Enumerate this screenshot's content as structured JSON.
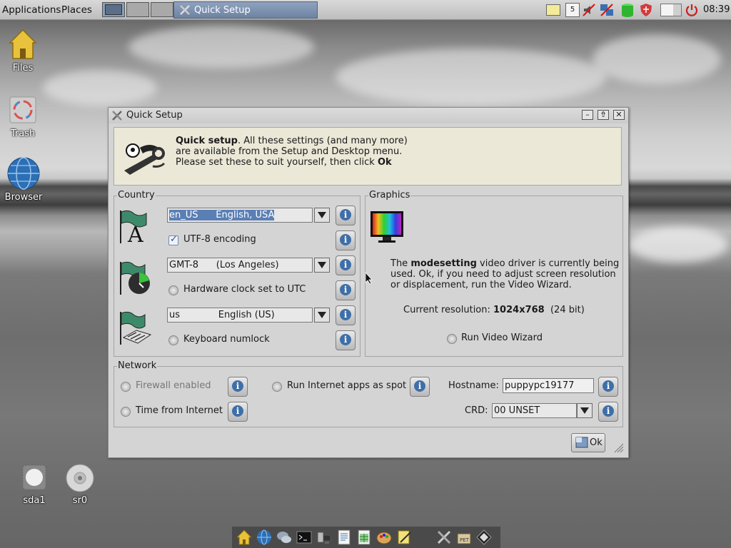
{
  "top_panel": {
    "menus": [
      "Applications",
      "Places"
    ],
    "task_title": "Quick Setup",
    "clock": "08:39",
    "tray_icons": [
      "notes-icon",
      "calendar-icon",
      "no-sound-icon",
      "network-disconnected-icon",
      "storage-icon",
      "firewall-shield-icon",
      "battery-icon",
      "power-icon"
    ]
  },
  "desktop_icons": [
    {
      "name": "files-icon",
      "label": "Files"
    },
    {
      "name": "trash-icon",
      "label": "Trash"
    },
    {
      "name": "browser-icon",
      "label": "Browser"
    },
    {
      "name": "drive-sda1-icon",
      "label": "sda1"
    },
    {
      "name": "drive-sr0-icon",
      "label": "sr0"
    }
  ],
  "window": {
    "title": "Quick Setup",
    "banner": {
      "line1_bold": "Quick setup",
      "line1_rest": ". All these settings (and many more)",
      "line2": "are available from the Setup and Desktop menu.",
      "line3_pre": "Please set these to suit yourself, then click ",
      "line3_bold": "Ok"
    },
    "country": {
      "title": "Country",
      "locale": "en_US      English, USA",
      "utf8_label": "UTF-8 encoding",
      "utf8_checked": true,
      "timezone": "GMT-8      (Los Angeles)",
      "hwclock_label": "Hardware clock set to UTC",
      "keyboard": "us             English (US)",
      "numlock_label": "Keyboard numlock"
    },
    "graphics": {
      "title": "Graphics",
      "text_pre": "The ",
      "text_bold": "modesetting",
      "text_rest1": " video driver is currently being",
      "text_line2": "used. Ok, if you need to adjust screen resolution",
      "text_line3": "or displacement, run the Video Wizard.",
      "resolution_label": "Current resolution: ",
      "resolution_value": "1024x768",
      "resolution_depth": "  (24 bit)",
      "wizard_label": "Run Video Wizard"
    },
    "network": {
      "title": "Network",
      "firewall_label": "Firewall enabled",
      "spot_label": "Run Internet apps as spot",
      "hostname_label": "Hostname:",
      "hostname_value": "puppypc19177",
      "time_label": "Time from Internet",
      "crd_label": "CRD:",
      "crd_value": "00 UNSET"
    },
    "ok_label": "Ok"
  }
}
